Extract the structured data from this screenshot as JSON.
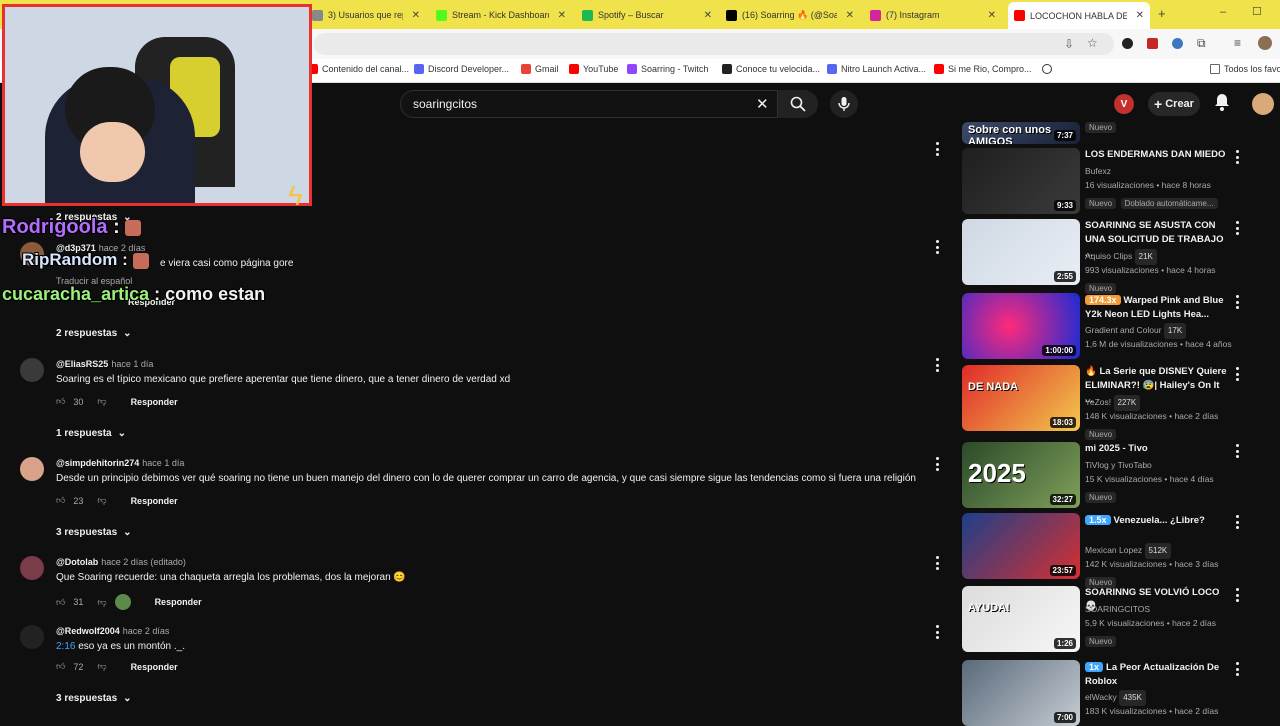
{
  "browser": {
    "tabs": [
      {
        "title": "3) Usuarios que reposte",
        "color": "#888"
      },
      {
        "title": "Stream - Kick Dashboard",
        "color": "#53fc18"
      },
      {
        "title": "Spotify – Buscar",
        "color": "#1db954"
      },
      {
        "title": "(16) Soarring 🔥 (@Soar",
        "color": "#000000"
      },
      {
        "title": "(7) Instagram",
        "color": "#d6249f"
      },
      {
        "title": "LOCOCHON HABLA DE S",
        "color": "#ff0000"
      }
    ],
    "new_tab": "+",
    "bookmarks": [
      {
        "label": "Contenido del canal...",
        "color": "#ff0000"
      },
      {
        "label": "Discord Developer...",
        "color": "#5865f2"
      },
      {
        "label": "Gmail",
        "color": "#ea4335"
      },
      {
        "label": "YouTube",
        "color": "#ff0000"
      },
      {
        "label": "Soarring - Twitch",
        "color": "#9146ff"
      },
      {
        "label": "Conoce tu velocida...",
        "color": "#222"
      },
      {
        "label": "Nitro Launch Activa...",
        "color": "#5865f2"
      },
      {
        "label": "Si me Rio, Compro...",
        "color": "#ff0000"
      }
    ],
    "all_favorites": "Todos los favo"
  },
  "youtube": {
    "search_value": "soaringcitos",
    "create_label": "Crear"
  },
  "comments": {
    "top_replies": "2 respuestas",
    "partial_comment": {
      "user": "@d3p371",
      "time": "hace 2 días",
      "text": "e viera casi como página gore",
      "translate": "Traducir al español",
      "reply": "Responder"
    },
    "replies_2": "2 respuestas",
    "items": [
      {
        "user": "@EliasRS25",
        "time": "hace 1 día",
        "text": "Soaring es el típico mexicano que prefiere aperentar que tiene dinero, que a tener dinero de verdad xd",
        "likes": "30",
        "reply": "Responder",
        "replies": "1 respuesta"
      },
      {
        "user": "@simpdehitorin274",
        "time": "hace 1 día",
        "text": "Desde un principio debimos ver qué soaring no tiene un buen manejo del dinero con lo de querer comprar un carro de agencia, y que casi siempre sigue las tendencias como si fuera una religión",
        "likes": "23",
        "reply": "Responder",
        "replies": "3 respuestas"
      },
      {
        "user": "@Dotolab",
        "time": "hace 2 días (editado)",
        "text": "Que Soaring recuerde: una chaqueta arregla los problemas, dos la mejoran 😊",
        "likes": "31",
        "reply": "Responder",
        "replies": ""
      },
      {
        "user": "@Redwolf2004",
        "time": "hace 2 días",
        "timestamp_link": "2:16",
        "text": "eso ya es un montón ._.",
        "likes": "72",
        "reply": "Responder",
        "replies": "3 respuestas"
      }
    ]
  },
  "sidebar_videos": [
    {
      "title": "",
      "channel": "",
      "meta": "",
      "badge": "Nuevo",
      "duration": "7:37",
      "thumb_text": "Sobre con unos AMIGOS"
    },
    {
      "title": "LOS ENDERMANS DAN MIEDO",
      "channel": "Bufexz",
      "meta": "16 visualizaciones • hace 8 horas",
      "badge": "Nuevo",
      "extra_badge": "Doblado automáticame...",
      "duration": "9:33"
    },
    {
      "title": "SOARINNG SE ASUSTA CON UNA SOLICITUD DE TRABAJO ...",
      "channel": "Aquiso Clips",
      "subs": "21K",
      "meta": "993 visualizaciones • hace 4 horas",
      "badge": "Nuevo",
      "duration": "2:55"
    },
    {
      "title": "Warped Pink and Blue Y2k Neon LED Lights Hea...",
      "speed": "174.3x",
      "channel": "Gradient and Colour",
      "subs": "17K",
      "meta": "1,6 M de visualizaciones • hace 4 años",
      "badge": "",
      "duration": "1:00:00"
    },
    {
      "title": "🔥 La Serie que DISNEY Quiere ELIMINAR?! 😰| Hailey's On It ...",
      "channel": "YeZos!",
      "subs": "227K",
      "meta": "148 K visualizaciones • hace 2 días",
      "badge": "Nuevo",
      "duration": "18:03",
      "thumb_text": "DE NADA"
    },
    {
      "title": "mi 2025 - Tivo",
      "channel": "TiVlog y TivoTabo",
      "meta": "15 K visualizaciones • hace 4 días",
      "badge": "Nuevo",
      "duration": "32:27",
      "thumb_text": "2025"
    },
    {
      "title": "Venezuela... ¿Libre?",
      "speed": "1.5x",
      "channel": "Mexican Lopez",
      "subs": "512K",
      "meta": "142 K visualizaciones • hace 3 días",
      "badge": "Nuevo",
      "duration": "23:57"
    },
    {
      "title": "SOARINNG SE VOLVIÓ LOCO 💀",
      "channel": "SOARINGCITOS",
      "meta": "5,9 K visualizaciones • hace 2 días",
      "badge": "Nuevo",
      "duration": "1:26",
      "thumb_text": "AYUDA!"
    },
    {
      "title": "La Peor Actualización De Roblox",
      "speed": "1x",
      "channel": "elWacky",
      "subs": "435K",
      "meta": "183 K visualizaciones • hace 2 días",
      "badge": "",
      "duration": "7:00"
    }
  ],
  "stream_overlay": {
    "chat": [
      {
        "user": "Rodrigoola",
        "sep": " : ",
        "msg": "",
        "color": "#b46cff"
      },
      {
        "user": "RipRandom",
        "sep": " : ",
        "msg": "",
        "color": "#d7e6ff"
      },
      {
        "user": "cucaracha_artica",
        "sep": " : ",
        "msg": "como estan",
        "color": "#9cf07b"
      }
    ]
  }
}
